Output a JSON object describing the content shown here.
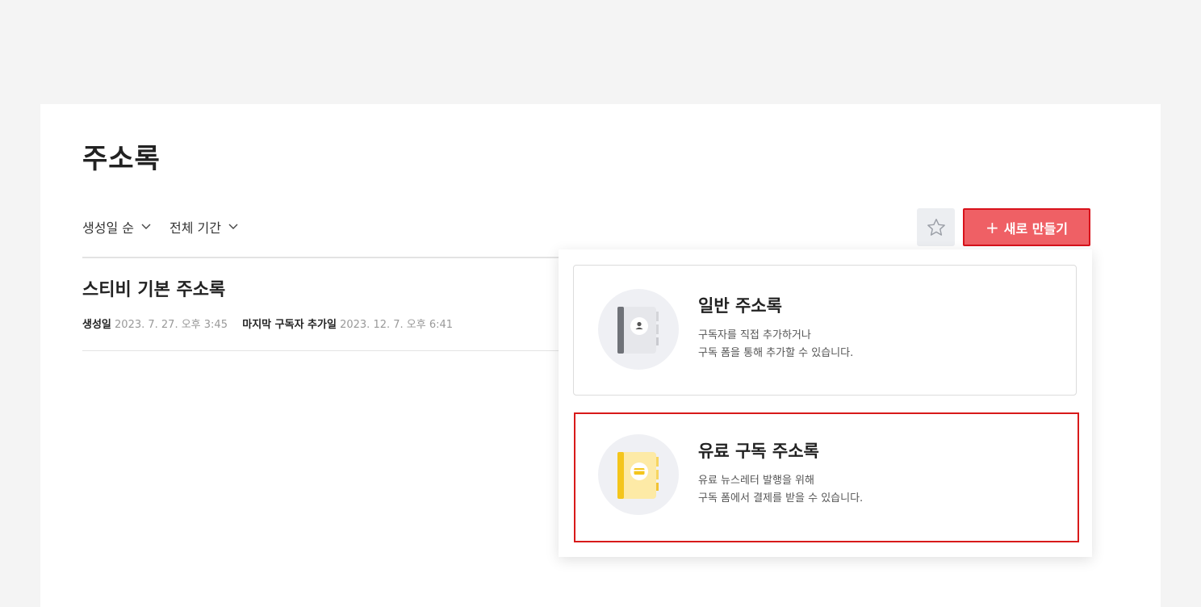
{
  "page": {
    "title": "주소록"
  },
  "filters": {
    "sort_label": "생성일 순",
    "period_label": "전체 기간"
  },
  "toolbar": {
    "new_label": "새로 만들기",
    "new_prefix": "+"
  },
  "address_book": {
    "title": "스티비 기본 주소록",
    "created_key": "생성일",
    "created_value": "2023. 7. 27. 오후 3:45",
    "last_added_key": "마지막 구독자 추가일",
    "last_added_value": "2023. 12. 7. 오후 6:41"
  },
  "menu": {
    "general": {
      "title": "일반 주소록",
      "desc_line1": "구독자를 직접 추가하거나",
      "desc_line2": "구독 폼을 통해 추가할 수 있습니다."
    },
    "paid": {
      "title": "유료 구독 주소록",
      "desc_line1": "유료 뉴스레터 발행을 위해",
      "desc_line2": "구독 폼에서 결제를 받을 수 있습니다."
    }
  },
  "colors": {
    "accent": "#ef6065",
    "highlight_border": "#d81a1a",
    "yellow": "#f4c51b",
    "gray_book": "#6f7278"
  }
}
